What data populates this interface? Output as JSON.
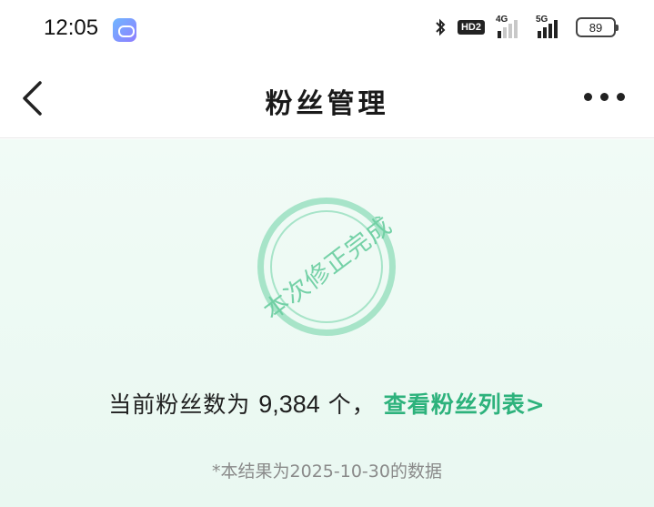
{
  "status_bar": {
    "time": "12:05",
    "hd_label": "HD2",
    "net1": "4G",
    "net2": "5G",
    "battery": "89"
  },
  "nav": {
    "title": "粉丝管理"
  },
  "stamp": {
    "text": "本次修正完成"
  },
  "main": {
    "count_prefix": "当前粉丝数为",
    "count_value": "9,384",
    "count_suffix": "个，",
    "link_label": "查看粉丝列表>",
    "note": "*本结果为2025-10-30的数据"
  },
  "colors": {
    "accent": "#2db27c",
    "stamp": "#8fdcba",
    "background": "#eef9f3"
  }
}
